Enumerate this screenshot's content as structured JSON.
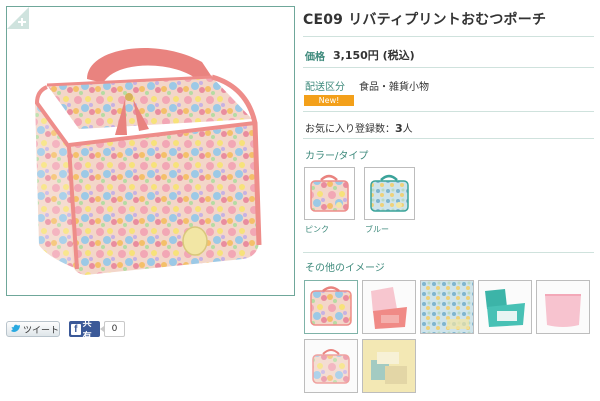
{
  "product": {
    "title": "CE09 リバティプリントおむつポーチ",
    "price_label": "価格",
    "price_value": "3,150円 (税込)",
    "shipping_label": "配送区分",
    "shipping_value": "食品・雑貨小物",
    "new_badge": "New!",
    "favorites_label": "お気に入り登録数：",
    "favorites_count": "3",
    "favorites_unit": "人"
  },
  "color_type": {
    "heading": "カラー/タイプ",
    "options": [
      {
        "label": "ピンク"
      },
      {
        "label": "ブルー"
      }
    ]
  },
  "other_images": {
    "heading": "その他のイメージ"
  },
  "share": {
    "tweet_label": "ツイート",
    "facebook_label": "共有",
    "facebook_count": "0"
  },
  "colors": {
    "accent": "#3e8a7c",
    "border": "#6fa79a",
    "badge": "#f3a01a",
    "facebook": "#3b5998"
  },
  "icons": [
    "zoom-plus-icon",
    "twitter-bird-icon",
    "facebook-f-icon"
  ]
}
